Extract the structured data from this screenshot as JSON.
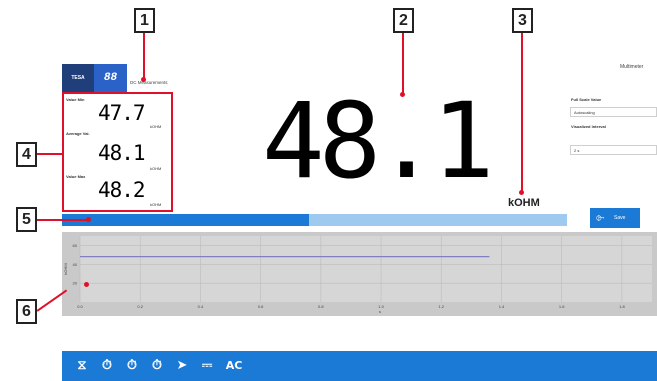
{
  "callouts": [
    "1",
    "2",
    "3",
    "4",
    "5",
    "6"
  ],
  "header": {
    "logo_text": "TESA",
    "logo_digits": "88",
    "mode_label": "DC Measurements",
    "multimeter_label": "Multimeter"
  },
  "display": {
    "main_value": "48.1",
    "unit": "kOHM"
  },
  "stats": {
    "min_label": "Value Min",
    "min_value": "47.7",
    "min_unit": "kOHM",
    "avg_label": "Average Val.",
    "avg_value": "48.1",
    "avg_unit": "kOHM",
    "max_label": "Value Max",
    "max_value": "48.2",
    "max_unit": "kOHM"
  },
  "settings": {
    "full_scale_label": "Full Scale Value",
    "full_scale_value": "Autoscaling",
    "interval_label": "Visualized Interval",
    "interval_value": "2 s"
  },
  "progress": {
    "fraction": 0.49,
    "fill_color": "#1a7ad6",
    "track_color": "#9fcaf0"
  },
  "save_button": {
    "label": "Save",
    "icon": "save-icon"
  },
  "chart_data": {
    "type": "line",
    "ylabel": "kOHM",
    "xlabel": "s",
    "x_ticks": [
      "0.0",
      "0.2",
      "0.4",
      "0.6",
      "0.8",
      "1.0",
      "1.2",
      "1.4",
      "1.6",
      "1.8"
    ],
    "y_ticks": [
      "60",
      "40",
      "20"
    ],
    "series": [
      {
        "x": [
          0.0,
          1.36
        ],
        "y": [
          48.1,
          48.1
        ],
        "color": "#8080c0"
      }
    ],
    "xlim": [
      0.0,
      1.9
    ],
    "ylim": [
      0,
      70
    ],
    "grid": true
  },
  "taskbar": {
    "icons": [
      "probe-icon",
      "stopwatch-icon",
      "stopwatch-icon",
      "stopwatch-icon",
      "diode-icon",
      "dc-icon"
    ],
    "ac_label": "AC"
  }
}
